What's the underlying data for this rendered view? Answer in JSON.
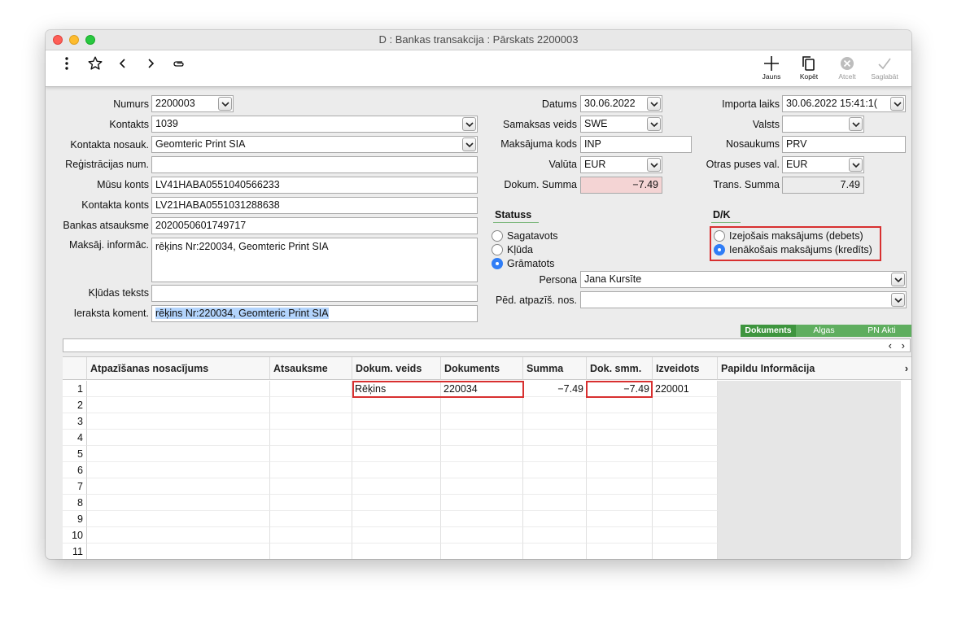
{
  "window": {
    "title": "D : Bankas transakcija : Pārskats 2200003"
  },
  "toolbar": {
    "left_icons": [
      "more-vertical-icon",
      "star-icon",
      "chevron-left-icon",
      "chevron-right-icon",
      "paperclip-icon"
    ],
    "buttons": {
      "new": {
        "label": "Jauns",
        "icon": "plus-icon"
      },
      "copy": {
        "label": "Kopēt",
        "icon": "copy-icon"
      },
      "cancel": {
        "label": "Atcelt",
        "icon": "cancel-circle-icon"
      },
      "save": {
        "label": "Saglabāt",
        "icon": "checkmark-icon"
      }
    }
  },
  "form": {
    "numurs": {
      "label": "Numurs",
      "value": "2200003"
    },
    "kontakts": {
      "label": "Kontakts",
      "value": "1039"
    },
    "kontakta_nosauk": {
      "label": "Kontakta nosauk.",
      "value": "Geomteric Print SIA"
    },
    "registracijas_num": {
      "label": "Reģistrācijas num.",
      "value": ""
    },
    "musu_konts": {
      "label": "Mūsu konts",
      "value": "LV41HABA0551040566233"
    },
    "kontakta_konts": {
      "label": "Kontakta konts",
      "value": "LV21HABA0551031288638"
    },
    "bankas_atsauksme": {
      "label": "Bankas atsauksme",
      "value": "2020050601749717"
    },
    "maksaj_informac": {
      "label": "Maksāj. informāc.",
      "value": "rēķins Nr:220034, Geomteric Print SIA"
    },
    "kludas_teksts": {
      "label": "Kļūdas teksts",
      "value": ""
    },
    "ieraksta_koment": {
      "label": "Ieraksta koment.",
      "value": "rēķins Nr:220034, Geomteric Print SIA"
    },
    "datums": {
      "label": "Datums",
      "value": "30.06.2022"
    },
    "samaksas_veids": {
      "label": "Samaksas veids",
      "value": "SWE"
    },
    "maksajuma_kods": {
      "label": "Maksājuma kods",
      "value": "INP"
    },
    "valuta": {
      "label": "Valūta",
      "value": "EUR"
    },
    "dokum_summa": {
      "label": "Dokum. Summa",
      "value": "−7.49"
    },
    "importa_laiks": {
      "label": "Importa laiks",
      "value": "30.06.2022 15:41:1("
    },
    "valsts": {
      "label": "Valsts",
      "value": ""
    },
    "nosaukums": {
      "label": "Nosaukums",
      "value": "PRV"
    },
    "otras_puses_val": {
      "label": "Otras puses val.",
      "value": "EUR"
    },
    "trans_summa": {
      "label": "Trans. Summa",
      "value": "7.49"
    },
    "persona": {
      "label": "Persona",
      "value": "Jana Kursīte"
    },
    "ped_atpazis_nos": {
      "label": "Pēd. atpazīš. nos.",
      "value": ""
    }
  },
  "statuss": {
    "title": "Statuss",
    "options": [
      {
        "label": "Sagatavots",
        "selected": false
      },
      {
        "label": "Kļūda",
        "selected": false
      },
      {
        "label": "Grāmatots",
        "selected": true
      }
    ]
  },
  "dk": {
    "title": "D/K",
    "options": [
      {
        "label": "Izejošais maksājums (debets)",
        "selected": false
      },
      {
        "label": "Ienākošais maksājums (kredīts)",
        "selected": true
      }
    ]
  },
  "tabs": [
    {
      "label": "Dokuments",
      "active": true
    },
    {
      "label": "Algas",
      "active": false
    },
    {
      "label": "PN Akti",
      "active": false
    }
  ],
  "scroll_strip": {
    "left": "‹",
    "right": "›"
  },
  "grid": {
    "columns": [
      "Atpazīšanas nosacījums",
      "Atsauksme",
      "Dokum. veids",
      "Dokuments",
      "Summa",
      "Dok. smm.",
      "Izveidots",
      "Papildu Informācija"
    ],
    "header_more": "›",
    "rows": [
      {
        "n": "1",
        "atpaz": "",
        "atsauksme": "",
        "veids": "Rēķins",
        "dokuments": "220034",
        "summa": "−7.49",
        "dok_smm": "−7.49",
        "izveidots": "220001"
      },
      {
        "n": "2"
      },
      {
        "n": "3"
      },
      {
        "n": "4"
      },
      {
        "n": "5"
      },
      {
        "n": "6"
      },
      {
        "n": "7"
      },
      {
        "n": "8"
      },
      {
        "n": "9"
      },
      {
        "n": "10"
      },
      {
        "n": "11"
      }
    ]
  },
  "colors": {
    "accent": "#2f7df6",
    "highlight_border": "#d83030",
    "tab_green": "#5fae5f",
    "pink_field": "#f4d4d4"
  }
}
